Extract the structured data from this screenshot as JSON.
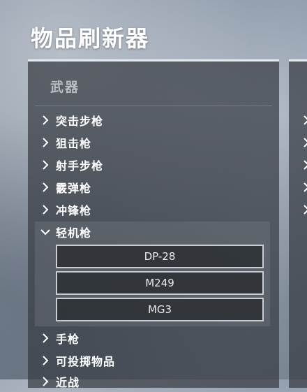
{
  "title": "物品刷新器",
  "panel": {
    "section_header": "武器",
    "categories_before": [
      {
        "label": "突击步枪"
      },
      {
        "label": "狙击枪"
      },
      {
        "label": "射手步枪"
      },
      {
        "label": "霰弹枪"
      },
      {
        "label": "冲锋枪"
      }
    ],
    "expanded": {
      "label": "轻机枪",
      "items": [
        "DP-28",
        "M249",
        "MG3"
      ]
    },
    "categories_after": [
      {
        "label": "手枪"
      },
      {
        "label": "可投掷物品"
      },
      {
        "label": "近战"
      }
    ]
  },
  "icons": {
    "collapsed": "chevron-right-icon",
    "expanded": "chevron-down-icon"
  },
  "colors": {
    "panel_top_border": "#e9ecef",
    "item_border": "#c9cdd1",
    "text": "#ffffff"
  }
}
